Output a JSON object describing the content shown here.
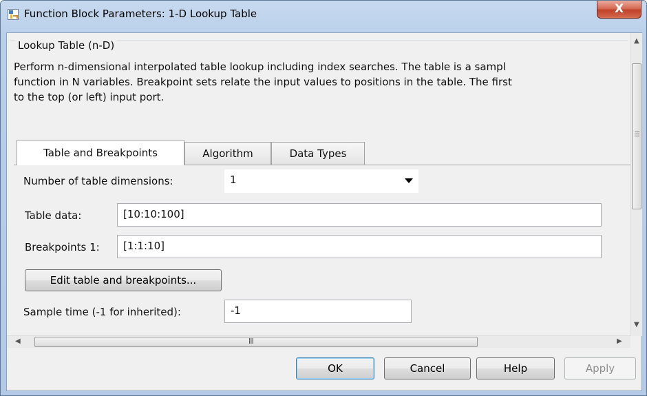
{
  "window": {
    "title": "Function Block Parameters: 1-D Lookup Table",
    "close_symbol": "X"
  },
  "group": {
    "title": "Lookup Table (n-D)",
    "description_lines": [
      "Perform n-dimensional interpolated table lookup including index searches. The table is a sampl",
      "function in N variables. Breakpoint sets relate the input values to positions in the table. The first",
      "to the top (or left) input port."
    ]
  },
  "tabs": [
    {
      "label": "Table and Breakpoints",
      "active": true
    },
    {
      "label": "Algorithm",
      "active": false
    },
    {
      "label": "Data Types",
      "active": false
    }
  ],
  "form": {
    "dimensions_label": "Number of table dimensions:",
    "dimensions_value": "1",
    "table_data_label": "Table data:",
    "table_data_value": "[10:10:100]",
    "breakpoints_label": "Breakpoints 1:",
    "breakpoints_value": "[1:1:10]",
    "edit_button": "Edit table and breakpoints...",
    "sample_time_label": "Sample time (-1 for inherited):",
    "sample_time_value": "-1"
  },
  "scrollbar": {
    "h_grip": "III"
  },
  "buttons": {
    "ok": "OK",
    "cancel": "Cancel",
    "help": "Help",
    "apply": "Apply"
  },
  "icons": {
    "app": "simulink-block-icon",
    "close": "close-icon"
  },
  "colors": {
    "titlebar": "#b8cee9",
    "close_button": "#c0412a",
    "dialog_bg": "#f0f0f0",
    "default_button_border": "#3c7fb1"
  }
}
